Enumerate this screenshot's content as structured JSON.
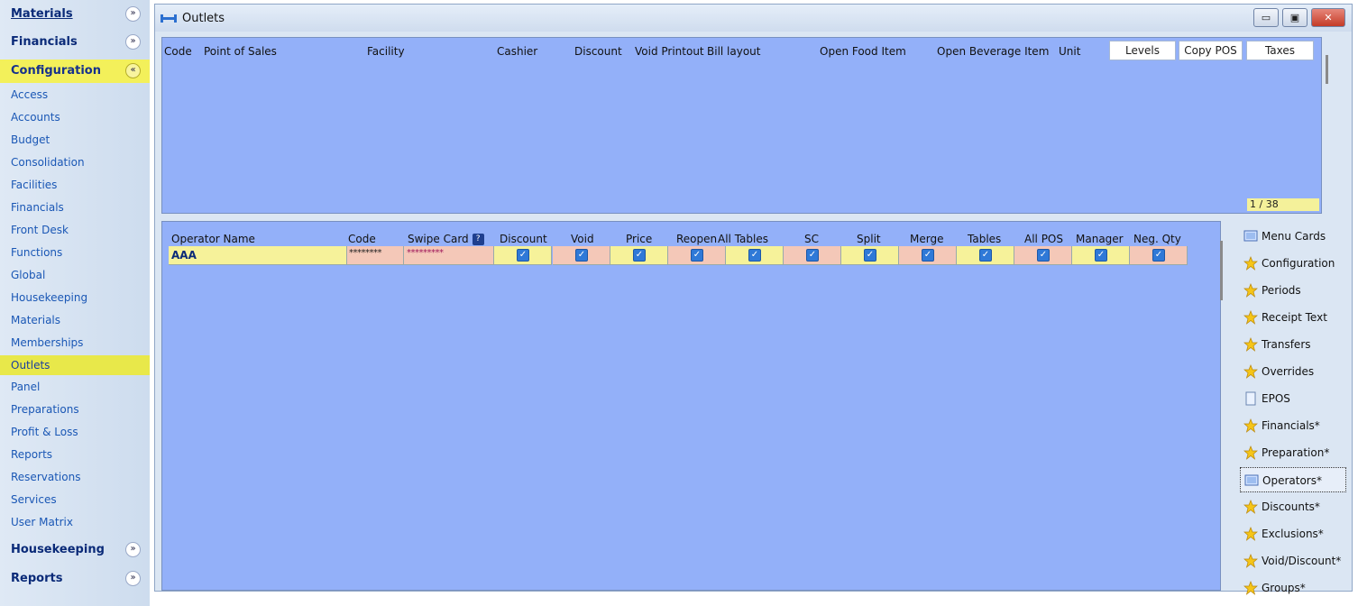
{
  "nav": {
    "sections_top": [
      {
        "label": "Materials",
        "chevron": "»"
      },
      {
        "label": "Financials",
        "chevron": "»"
      },
      {
        "label": "Configuration",
        "chevron": "«"
      }
    ],
    "items": [
      "Access",
      "Accounts",
      "Budget",
      "Consolidation",
      "Facilities",
      "Financials",
      "Front Desk",
      "Functions",
      "Global",
      "Housekeeping",
      "Materials",
      "Memberships",
      "Outlets",
      "Panel",
      "Preparations",
      "Profit & Loss",
      "Reports",
      "Reservations",
      "Services",
      "User Matrix"
    ],
    "selected_item": "Outlets",
    "sections_bottom": [
      {
        "label": "Housekeeping",
        "chevron": "»"
      },
      {
        "label": "Reports",
        "chevron": "»"
      }
    ]
  },
  "window": {
    "title": "Outlets",
    "controls": {
      "minimize": "▭",
      "maximize": "▣",
      "close": "✕"
    }
  },
  "outlets": {
    "columns": [
      "Code",
      "Point of Sales",
      "Facility",
      "Cashier",
      "Discount",
      "Void Printout",
      "Bill layout",
      "Open Food Item",
      "Open Beverage Item",
      "Unit"
    ],
    "buttons": {
      "levels": "Levels",
      "copy_pos": "Copy POS",
      "taxes": "Taxes"
    },
    "counter": "1 / 38"
  },
  "operators": {
    "columns": [
      "Operator Name",
      "Code",
      "Swipe Card",
      "Discount",
      "Void",
      "Price",
      "Reopen",
      "All Tables",
      "SC",
      "Split",
      "Merge",
      "Tables",
      "All POS",
      "Manager",
      "Neg. Qty"
    ],
    "help_badge": "?",
    "rows": [
      {
        "name": "AAA",
        "code": "********",
        "swipe": "*********",
        "flags": [
          true,
          true,
          true,
          true,
          true,
          true,
          true,
          true,
          true,
          true,
          true,
          true
        ]
      }
    ]
  },
  "right_panel": {
    "items": [
      {
        "label": "Menu Cards",
        "icon": "menu-cards-icon"
      },
      {
        "label": "Configuration",
        "icon": "star-folder-icon"
      },
      {
        "label": "Periods",
        "icon": "star-folder-icon"
      },
      {
        "label": "Receipt Text",
        "icon": "star-folder-icon"
      },
      {
        "label": "Transfers",
        "icon": "star-folder-icon"
      },
      {
        "label": "Overrides",
        "icon": "star-folder-icon"
      },
      {
        "label": "EPOS",
        "icon": "document-icon"
      },
      {
        "label": "Financials*",
        "icon": "star-folder-icon"
      },
      {
        "label": "Preparation*",
        "icon": "star-folder-icon"
      },
      {
        "label": "Operators*",
        "icon": "operators-icon"
      },
      {
        "label": "Discounts*",
        "icon": "star-folder-icon"
      },
      {
        "label": "Exclusions*",
        "icon": "star-folder-icon"
      },
      {
        "label": "Void/Discount*",
        "icon": "star-folder-icon"
      },
      {
        "label": "Groups*",
        "icon": "star-folder-icon"
      }
    ],
    "selected": "Operators*"
  },
  "colors": {
    "grid_bg": "#93b0f9",
    "nav_selected": "#e8e84a",
    "row_highlight": "#f6f29a",
    "cell_pink": "#f4c8b8"
  }
}
